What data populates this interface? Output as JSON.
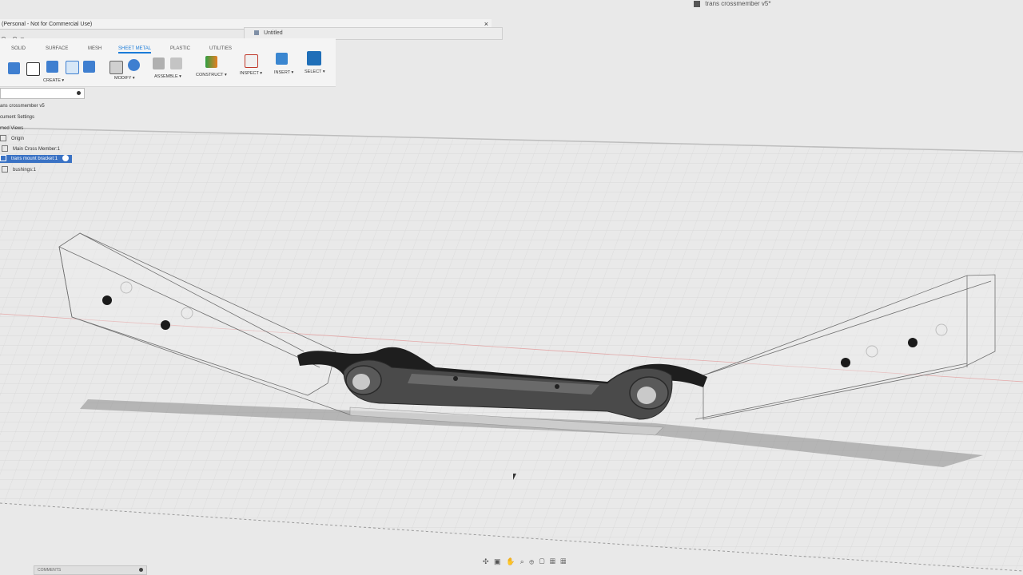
{
  "window": {
    "title": "(Personal - Not for Commercial Use)",
    "close_glyph": "×",
    "quick_access": "↶ · ↷ ▾"
  },
  "document": {
    "tab_label": "Untitled",
    "right_tab_label": "trans crossmember v5*"
  },
  "ribbon": {
    "tabs": [
      "SOLID",
      "SURFACE",
      "MESH",
      "SHEET METAL",
      "PLASTIC",
      "UTILITIES"
    ],
    "active_tab": "SHEET METAL",
    "groups": [
      "CREATE ▾",
      "MODIFY ▾",
      "ASSEMBLE ▾",
      "CONSTRUCT ▾",
      "INSPECT ▾",
      "INSERT ▾",
      "SELECT ▾"
    ]
  },
  "browser": {
    "root": "ans crossmember v5",
    "nodes": [
      "cument Settings",
      "med Views",
      "Origin",
      "Main Cross Member:1",
      "trans mount bracket:1",
      "bushings:1"
    ],
    "selected_node": "trans mount bracket:1"
  },
  "bottom": {
    "comments_label": "COMMENTS",
    "nav_glyphs": "✣ ▣ ✋ ⌕ ⊕ ▢ ▦ ▦"
  },
  "colors": {
    "accent": "#1a7bd8",
    "selection": "#3a72c4",
    "viewport_bg": "#e6e6e6",
    "grid_line": "#cfcfcf",
    "part_dark": "#3d3d3d"
  }
}
